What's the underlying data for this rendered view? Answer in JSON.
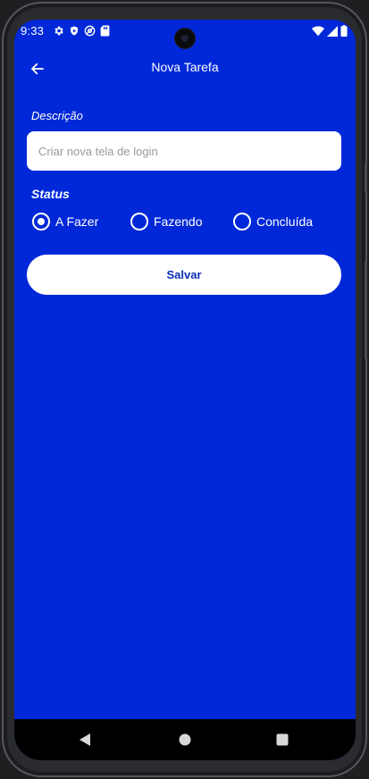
{
  "status_bar": {
    "time": "9:33",
    "left_icons": [
      "gear-icon",
      "shield-icon",
      "at-sign-icon",
      "sd-card-icon"
    ],
    "right_icons": [
      "wifi-icon",
      "signal-icon",
      "battery-icon"
    ]
  },
  "app_bar": {
    "title": "Nova Tarefa",
    "back_icon": "arrow-left-icon"
  },
  "form": {
    "description_label": "Descrição",
    "description_placeholder": "Criar nova tela de login",
    "description_value": "",
    "status_label": "Status",
    "status_options": [
      {
        "label": "A Fazer",
        "selected": true
      },
      {
        "label": "Fazendo",
        "selected": false
      },
      {
        "label": "Concluída",
        "selected": false
      }
    ],
    "save_label": "Salvar"
  },
  "nav_bar": {
    "buttons": [
      "back-triangle-icon",
      "home-circle-icon",
      "recents-square-icon"
    ]
  },
  "colors": {
    "background": "#0028d8",
    "button_text": "#0a2fb5",
    "surface": "#ffffff"
  }
}
